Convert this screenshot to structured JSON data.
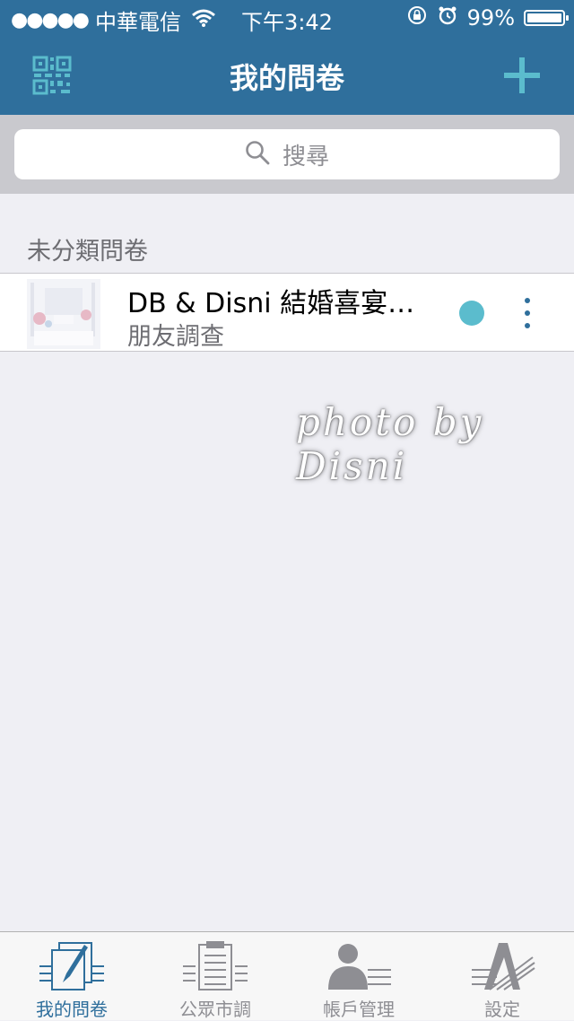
{
  "status_bar": {
    "signal_dots": "●●●●●",
    "carrier": "中華電信",
    "wifi_icon": "wifi-icon",
    "time": "下午3:42",
    "battery_percent": "99%",
    "battery_level": 0.99
  },
  "nav": {
    "title": "我的問卷",
    "left_icon": "qr-code-icon",
    "right_icon": "plus-icon"
  },
  "search": {
    "placeholder": "搜尋",
    "icon": "search-icon"
  },
  "section": {
    "title": "未分類問卷"
  },
  "surveys": [
    {
      "name": "DB & Disni 結婚喜宴…",
      "subtitle": "朋友調查",
      "status_color": "#5bbccd"
    }
  ],
  "watermark": "photo by Disni",
  "tabs": [
    {
      "label": "我的問卷",
      "icon": "my-survey-icon",
      "active": true
    },
    {
      "label": "公眾市調",
      "icon": "clipboard-icon",
      "active": false
    },
    {
      "label": "帳戶管理",
      "icon": "account-icon",
      "active": false
    },
    {
      "label": "設定",
      "icon": "settings-icon",
      "active": false
    }
  ],
  "colors": {
    "primary": "#2f6f9c",
    "accent": "#5bbccd",
    "background": "#efeff4"
  }
}
